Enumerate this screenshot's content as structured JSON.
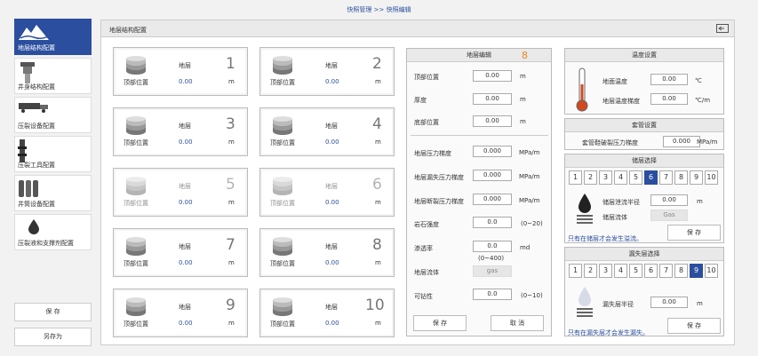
{
  "breadcrumb": "快照管理 >> 快照编辑",
  "sidebar": {
    "items": [
      {
        "label": "地层结构配置",
        "icon": "mountain-icon",
        "active": true
      },
      {
        "label": "井身结构配置",
        "icon": "wellbore-icon"
      },
      {
        "label": "压裂设备配置",
        "icon": "truck-icon"
      },
      {
        "label": "压裂工具配置",
        "icon": "tool-icon"
      },
      {
        "label": "井筒设备配置",
        "icon": "tanks-icon"
      },
      {
        "label": "压裂液和支撑剂配置",
        "icon": "drop-icon"
      }
    ],
    "save_label": "保 存",
    "save_as_label": "另存为"
  },
  "main": {
    "title": "地层结构配置"
  },
  "layers": [
    {
      "name": "地层",
      "number": "1",
      "top_label": "顶部位置",
      "top_value": "0.00",
      "unit": "m"
    },
    {
      "name": "地层",
      "number": "2",
      "top_label": "顶部位置",
      "top_value": "0.00",
      "unit": "m"
    },
    {
      "name": "地层",
      "number": "3",
      "top_label": "顶部位置",
      "top_value": "0.00",
      "unit": "m"
    },
    {
      "name": "地层",
      "number": "4",
      "top_label": "顶部位置",
      "top_value": "0.00",
      "unit": "m"
    },
    {
      "name": "地层",
      "number": "5",
      "top_label": "顶部位置",
      "top_value": "0.00",
      "unit": "m"
    },
    {
      "name": "地层",
      "number": "6",
      "top_label": "顶部位置",
      "top_value": "0.00",
      "unit": "m"
    },
    {
      "name": "地层",
      "number": "7",
      "top_label": "顶部位置",
      "top_value": "0.00",
      "unit": "m"
    },
    {
      "name": "地层",
      "number": "8",
      "top_label": "顶部位置",
      "top_value": "0.00",
      "unit": "m"
    },
    {
      "name": "地层",
      "number": "9",
      "top_label": "顶部位置",
      "top_value": "0.00",
      "unit": "m"
    },
    {
      "name": "地层",
      "number": "10",
      "top_label": "顶部位置",
      "top_value": "0.00",
      "unit": "m"
    }
  ],
  "edit": {
    "title": "地层编辑",
    "selected_number": "8",
    "top": {
      "label": "顶部位置",
      "value": "0.00",
      "unit": "m"
    },
    "thickness": {
      "label": "厚度",
      "value": "0.00",
      "unit": "m"
    },
    "bottom": {
      "label": "底部位置",
      "value": "0.00",
      "unit": "m"
    },
    "pressure_grad": {
      "label": "地层压力梯度",
      "value": "0.000",
      "unit": "MPa/m"
    },
    "loss_grad": {
      "label": "地层漏失压力梯度",
      "value": "0.000",
      "unit": "MPa/m"
    },
    "frac_grad": {
      "label": "地层断裂压力梯度",
      "value": "0.000",
      "unit": "MPa/m"
    },
    "rock_strength": {
      "label": "岩石强度",
      "value": "0.0",
      "range": "(0~20)"
    },
    "permeability": {
      "label": "渗透率",
      "value": "0.0",
      "unit": "md",
      "range": "(0~400)"
    },
    "fluid": {
      "label": "地层流体",
      "value": "gas"
    },
    "drillability": {
      "label": "可钻性",
      "value": "0.0",
      "range": "(0~10)"
    },
    "save_label": "保 存",
    "cancel_label": "取 消"
  },
  "temperature": {
    "title": "温度设置",
    "surface": {
      "label": "地面温度",
      "value": "0.00",
      "unit": "℃"
    },
    "gradient": {
      "label": "地层温度梯度",
      "value": "0.00",
      "unit": "℃/m"
    }
  },
  "casing": {
    "title": "套管设置",
    "shoe": {
      "label": "套管鞋破裂压力梯度",
      "value": "0.000",
      "unit": "MPa/m"
    }
  },
  "reservoir": {
    "title": "储层选择",
    "options": [
      "1",
      "2",
      "3",
      "4",
      "5",
      "6",
      "7",
      "8",
      "9",
      "10"
    ],
    "selected": "6",
    "radius": {
      "label": "储层泄流半径",
      "value": "0.00",
      "unit": "m"
    },
    "fluid": {
      "label": "储层流体",
      "value": "Gas"
    },
    "note": "只有在储层才会发生溢流。",
    "save_label": "保 存"
  },
  "leak": {
    "title": "漏失层选择",
    "options": [
      "1",
      "2",
      "3",
      "4",
      "5",
      "6",
      "7",
      "8",
      "9",
      "10"
    ],
    "selected": "9",
    "radius": {
      "label": "漏失层半径",
      "value": "0.00",
      "unit": "m"
    },
    "note": "只有在漏失层才会发生漏失。",
    "save_label": "保 存"
  },
  "colors": {
    "accent": "#2b4e9e",
    "number_highlight": "#e8871e"
  }
}
